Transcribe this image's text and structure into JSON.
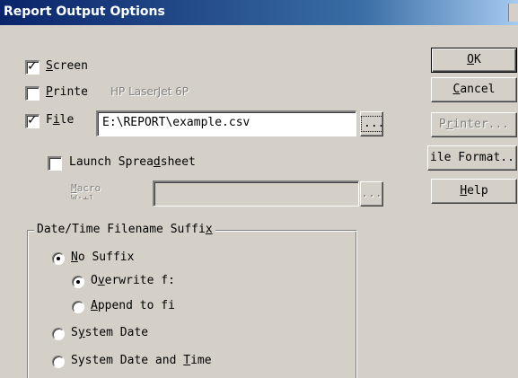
{
  "window": {
    "title": "Report Output Options"
  },
  "options": {
    "screen": {
      "label": "Screen",
      "underline": "S",
      "rest": "creen",
      "checked": true
    },
    "printer": {
      "underline": "P",
      "rest": "rinte",
      "checked": false,
      "device": "HP LaserJet 6P"
    },
    "file": {
      "prefix": "F",
      "underline": "i",
      "rest": "le",
      "checked": true,
      "path": "E:\\REPORT\\example.csv",
      "browse_label": "..."
    },
    "launch_spreadsheet": {
      "pre": "Launch Sprea",
      "underline": "d",
      "rest": "sheet",
      "checked": false
    },
    "macro": {
      "underline": "M",
      "rest": "acro",
      "line2": "W:+l",
      "value": "",
      "browse_label": "..."
    }
  },
  "buttons": {
    "ok": {
      "underline": "O",
      "rest": "K"
    },
    "cancel": {
      "underline": "C",
      "rest": "ancel"
    },
    "printer": {
      "pre": "P",
      "underline": "r",
      "rest": "inter..."
    },
    "file_format": {
      "label": "ile Format.."
    },
    "help": {
      "underline": "H",
      "rest": "elp"
    }
  },
  "suffix_group": {
    "legend_pre": "Date/Time Filename Suffi",
    "legend_underline": "x",
    "no_suffix": {
      "underline": "N",
      "rest": "o Suffix",
      "selected": true
    },
    "overwrite": {
      "pre": "O",
      "underline": "v",
      "rest": "erwrite f:",
      "selected": true
    },
    "append": {
      "underline": "A",
      "rest": "ppend to fi",
      "selected": false
    },
    "system_date": {
      "pre": "S",
      "underline": "y",
      "rest": "stem Date",
      "selected": false
    },
    "system_date_time": {
      "pre": "System Date and ",
      "underline": "T",
      "rest": "ime",
      "selected": false
    }
  },
  "colors": {
    "face": "#d4d0c8",
    "title_start": "#0a246a",
    "title_end": "#a6caf0"
  }
}
